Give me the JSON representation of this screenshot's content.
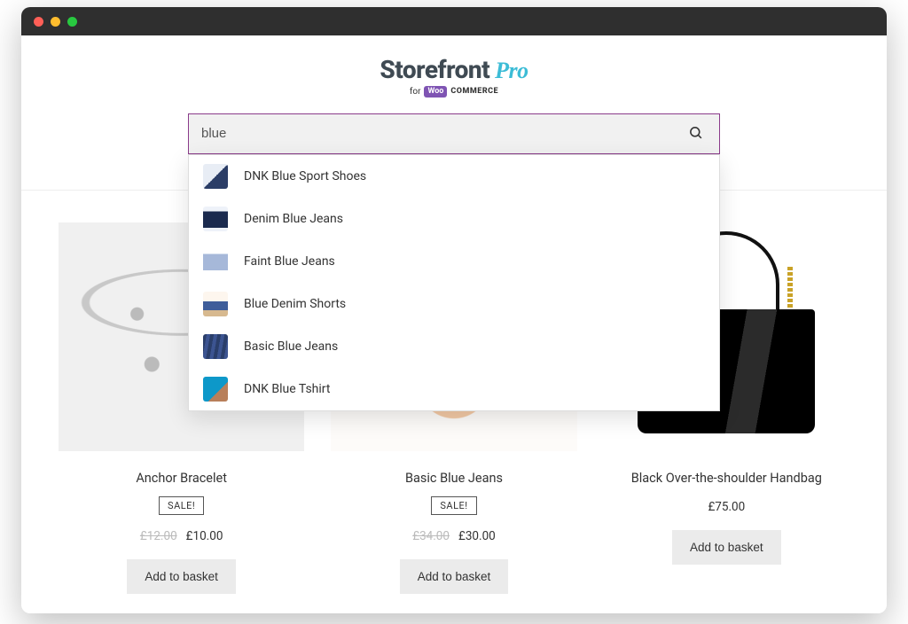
{
  "logo": {
    "brand": "Storefront",
    "suffix": "Pro",
    "for": "for",
    "woo": "Woo",
    "commerce": "COMMERCE"
  },
  "search": {
    "value": "blue",
    "placeholder": ""
  },
  "suggestions": [
    {
      "label": "DNK Blue Sport Shoes",
      "thumb": "thumb-shoes"
    },
    {
      "label": "Denim Blue Jeans",
      "thumb": "thumb-denim"
    },
    {
      "label": "Faint Blue Jeans",
      "thumb": "thumb-faint"
    },
    {
      "label": "Blue Denim Shorts",
      "thumb": "thumb-shorts"
    },
    {
      "label": "Basic Blue Jeans",
      "thumb": "thumb-basic"
    },
    {
      "label": "DNK Blue Tshirt",
      "thumb": "thumb-tshirt"
    }
  ],
  "products": [
    {
      "title": "Anchor Bracelet",
      "sale": "SALE!",
      "old_price": "£12.00",
      "price": "£10.00",
      "cta": "Add to basket",
      "img": "img-bracelet"
    },
    {
      "title": "Basic Blue Jeans",
      "sale": "SALE!",
      "old_price": "£34.00",
      "price": "£30.00",
      "cta": "Add to basket",
      "img": "img-jeans"
    },
    {
      "title": "Black Over-the-shoulder Handbag",
      "sale": "",
      "old_price": "",
      "price": "£75.00",
      "cta": "Add to basket",
      "img": "img-handbag"
    }
  ]
}
